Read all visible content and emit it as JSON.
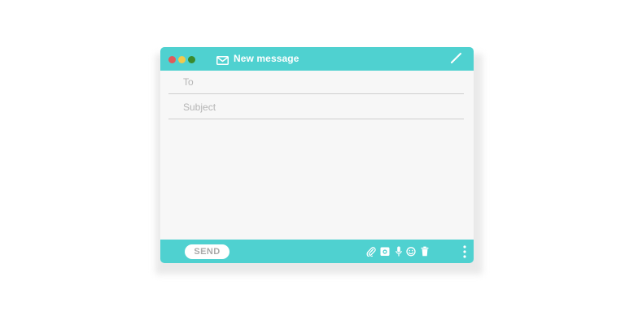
{
  "window": {
    "title": "New message",
    "traffic_lights": [
      {
        "name": "close",
        "color": "#e05a5a"
      },
      {
        "name": "minimize",
        "color": "#f2c94c"
      },
      {
        "name": "maximize",
        "color": "#3a8a2e"
      }
    ],
    "accent_color": "#4fd1d0"
  },
  "form": {
    "to_placeholder": "To",
    "subject_placeholder": "Subject"
  },
  "toolbar": {
    "send_label": "SEND",
    "icons": [
      "paperclip-icon",
      "camera-icon",
      "microphone-icon",
      "emoji-icon",
      "trash-icon",
      "more-vertical-icon"
    ]
  }
}
